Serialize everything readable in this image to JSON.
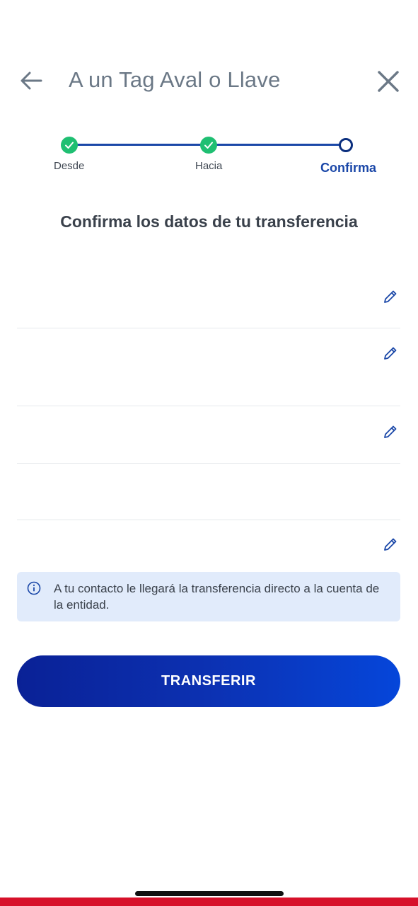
{
  "header": {
    "title": "A un Tag Aval o Llave",
    "back_icon": "arrow-left-icon",
    "close_icon": "close-icon"
  },
  "stepper": {
    "steps": [
      {
        "label": "Desde",
        "status": "done"
      },
      {
        "label": "Hacia",
        "status": "done"
      },
      {
        "label": "Confirma",
        "status": "current"
      }
    ],
    "colors": {
      "done": "#1fbf72",
      "line": "#1a47a8",
      "current": "#0b2f7e"
    }
  },
  "confirm": {
    "title": "Confirma los datos de tu transferencia"
  },
  "details": {
    "rows": [
      {
        "editable": true
      },
      {
        "editable": true
      },
      {
        "editable": true
      },
      {
        "editable": false
      },
      {
        "editable": true
      }
    ],
    "edit_icon": "pencil-icon"
  },
  "info": {
    "icon": "info-icon",
    "text": "A tu contacto le llegará la transferencia directo a la cuenta de la entidad."
  },
  "actions": {
    "transfer_label": "TRANSFERIR"
  },
  "colors": {
    "accent": "#1a47a8",
    "button_start": "#0a2196",
    "button_end": "#0546da",
    "info_bg": "#e1ebfb",
    "brand_bar": "#d7102a"
  }
}
